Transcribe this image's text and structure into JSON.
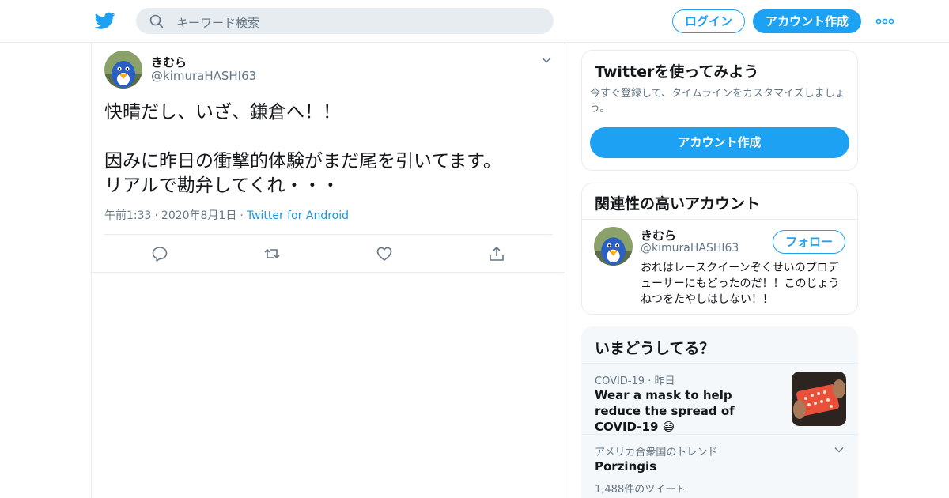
{
  "header": {
    "search_placeholder": "キーワード検索",
    "login_label": "ログイン",
    "signup_label": "アカウント作成",
    "logo_icon": "twitter-bird-icon",
    "more_icon": "more-dots-icon",
    "accent_color": "#1da1f2"
  },
  "tweet": {
    "display_name": "きむら",
    "handle": "@kimuraHASHI63",
    "lines": [
      "快晴だし、いざ、鎌倉へ！！",
      "",
      "因みに昨日の衝撃的体験がまだ尾を引いてます。",
      "リアルで勘弁してくれ・・・"
    ],
    "time": "午前1:33",
    "date": "2020年8月1日",
    "source": "Twitter for Android",
    "actions": [
      "reply-icon",
      "retweet-icon",
      "like-icon",
      "share-icon"
    ]
  },
  "signup_card": {
    "title": "Twitterを使ってみよう",
    "description": "今すぐ登録して、タイムラインをカスタマイズしましょう。",
    "button_label": "アカウント作成"
  },
  "related_card": {
    "title": "関連性の高いアカウント",
    "name": "きむら",
    "handle": "@kimuraHASHI63",
    "follow_label": "フォロー",
    "bio": "おれはレースクイーンぞくせいのプロデューサーにもどったのだ！！このじょうねつをたやしはしない！！"
  },
  "trends_card": {
    "title": "いまどうしてる？",
    "trend1": {
      "category": "COVID-19",
      "when": "昨日",
      "text": "Wear a mask to help reduce the spread of COVID-19 😷"
    },
    "trend2": {
      "location": "アメリカ合衆国のトレンド",
      "name": "Porzingis",
      "count": "1,488件のツイート"
    }
  }
}
